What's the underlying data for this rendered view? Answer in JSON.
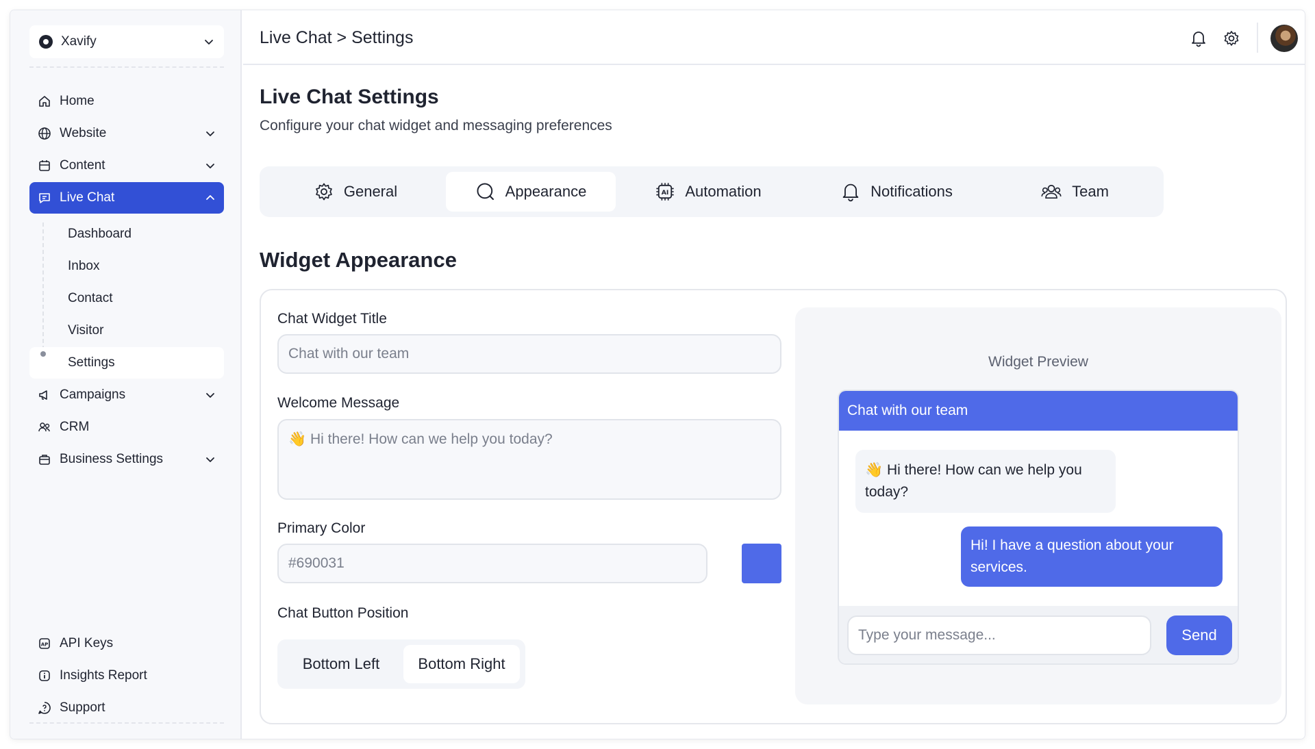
{
  "sidebar": {
    "workspace": "Xavify",
    "nav": [
      {
        "label": "Home",
        "icon": "home-icon"
      },
      {
        "label": "Website",
        "icon": "globe-icon"
      },
      {
        "label": "Content",
        "icon": "database-icon"
      },
      {
        "label": "Live Chat",
        "icon": "chat-icon"
      }
    ],
    "live_chat_sub": [
      "Dashboard",
      "Inbox",
      "Contact",
      "Visitor",
      "Settings"
    ],
    "nav_lower": [
      {
        "label": "Campaigns",
        "icon": "megaphone-icon"
      },
      {
        "label": "CRM",
        "icon": "users-icon"
      },
      {
        "label": "Business Settings",
        "icon": "briefcase-icon"
      }
    ],
    "bottom": [
      {
        "label": "API Keys",
        "icon": "api-icon"
      },
      {
        "label": "Insights Report",
        "icon": "info-icon"
      },
      {
        "label": "Support",
        "icon": "help-icon"
      }
    ]
  },
  "header": {
    "breadcrumb": "Live Chat > Settings"
  },
  "main": {
    "title": "Live Chat Settings",
    "subtitle": "Configure your chat widget and messaging preferences",
    "tabs": [
      {
        "label": "General",
        "icon": "gear-icon"
      },
      {
        "label": "Appearance",
        "icon": "search-icon"
      },
      {
        "label": "Automation",
        "icon": "ai-chip-icon"
      },
      {
        "label": "Notifications",
        "icon": "bell-icon"
      },
      {
        "label": "Team",
        "icon": "team-icon"
      }
    ],
    "active_tab": "Appearance",
    "section_title": "Widget Appearance",
    "form": {
      "title_label": "Chat Widget Title",
      "title_value": "Chat with our team",
      "welcome_label": "Welcome Message",
      "welcome_value": "👋 Hi there! How can we help you today?",
      "color_label": "Primary Color",
      "color_value": "#690031",
      "position_label": "Chat Button Position",
      "positions": [
        "Bottom Left",
        "Bottom Right"
      ],
      "selected_position": "Bottom Right"
    },
    "preview": {
      "label": "Widget Preview",
      "header": "Chat with our team",
      "incoming": "👋 Hi there! How can we help you today?",
      "outgoing": "Hi! I have a question about your services.",
      "input_placeholder": "Type your message...",
      "send": "Send"
    }
  },
  "colors": {
    "accent": "#3250d6",
    "preview_primary": "#4f6ae8"
  }
}
